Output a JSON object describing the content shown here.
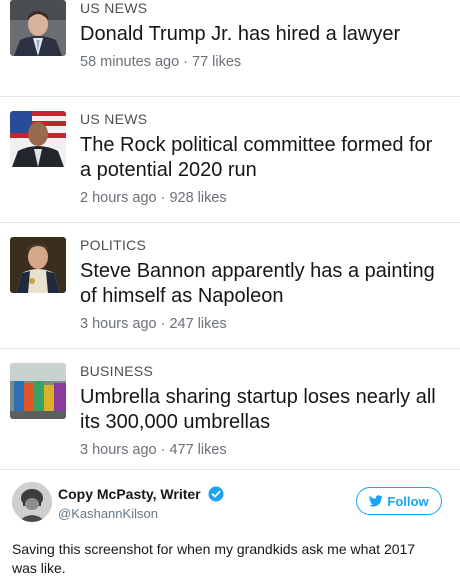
{
  "stories": [
    {
      "category": "US NEWS",
      "headline": "Donald Trump Jr. has hired a lawyer",
      "time": "58 minutes ago",
      "likes": "77 likes",
      "thumb_icon": "portrait-icon"
    },
    {
      "category": "US NEWS",
      "headline": "The Rock political committee formed for a potential 2020 run",
      "time": "2 hours ago",
      "likes": "928 likes",
      "thumb_icon": "portrait-icon"
    },
    {
      "category": "POLITICS",
      "headline": "Steve Bannon apparently has a painting of himself as Napoleon",
      "time": "3 hours ago",
      "likes": "247 likes",
      "thumb_icon": "painting-icon"
    },
    {
      "category": "BUSINESS",
      "headline": "Umbrella sharing startup loses nearly all its 300,000 umbrellas",
      "time": "3 hours ago",
      "likes": "477 likes",
      "thumb_icon": "street-icon"
    }
  ],
  "meta_separator": "·",
  "tweet": {
    "author_name": "Copy McPasty, Writer",
    "handle": "@KashannKilson",
    "follow_label": "Follow",
    "text": "Saving this screenshot for when my grandkids ask me what 2017 was like.",
    "verified_icon": "verified-badge-icon",
    "accent_color": "#1da1f2"
  }
}
